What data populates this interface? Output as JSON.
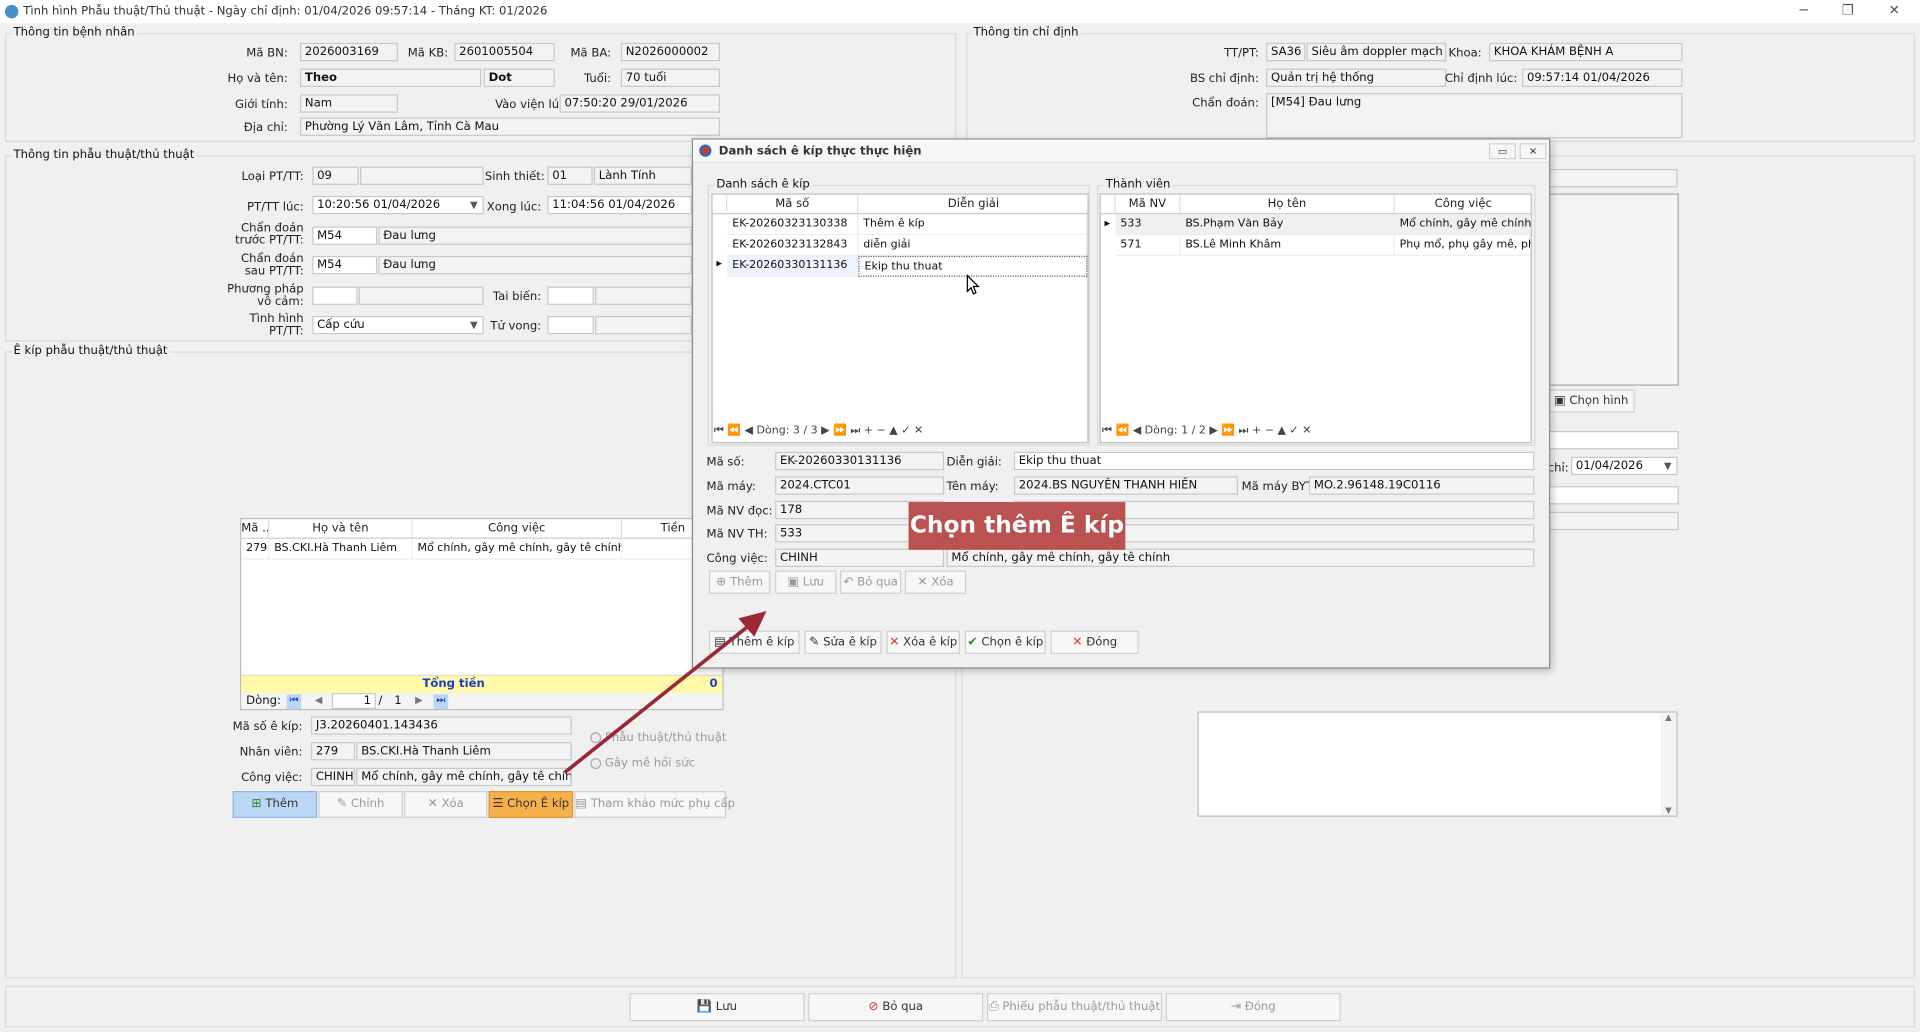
{
  "window": {
    "title": "Tình hình Phẫu thuật/Thủ thuật - Ngày chỉ định: 01/04/2026 09:57:14 - Tháng KT: 01/2026",
    "controls": [
      "─",
      "❐",
      "✕"
    ]
  },
  "patient_info": {
    "group_title": "Thông tin bệnh nhân",
    "ma_bn_label": "Mã BN:",
    "ma_bn": "2026003169",
    "ma_kb_label": "Mã KB:",
    "ma_kb": "2601005504",
    "ma_ba_label": "Mã BA:",
    "ma_ba": "N2026000002",
    "ho_ten_label": "Họ và tên:",
    "ho": "Theo",
    "ten": "Dot",
    "tuoi_label": "Tuổi:",
    "tuoi": "70 tuổi",
    "gioi_tinh_label": "Giới tính:",
    "gioi_tinh": "Nam",
    "vao_vien_label": "Vào viện lúc:",
    "vao_vien": "07:50:20 29/01/2026",
    "dia_chi_label": "Địa chỉ:",
    "dia_chi": "Phường Lý Văn Lâm, Tỉnh Cà Mau"
  },
  "order_info": {
    "group_title": "Thông tin chỉ định",
    "ttpt_label": "TT/PT:",
    "ttpt_code": "SA36",
    "ttpt_name": "Siêu âm doppler mạch máu",
    "khoa_label": "Khoa:",
    "khoa": "KHOA KHÁM BỆNH A",
    "bs_label": "BS chỉ định:",
    "bs": "Quản trị hệ thống",
    "chi_dinh_luc_label": "Chỉ định lúc:",
    "chi_dinh_luc": "09:57:14 01/04/2026",
    "chan_doan_label": "Chẩn đoán:",
    "chan_doan": "[M54] Đau lưng"
  },
  "surgery_info": {
    "group_title": "Thông tin phẫu thuật/thủ thuật",
    "loai_label": "Loại PT/TT:",
    "loai": "09",
    "sinh_thiet_label": "Sinh thiết:",
    "sinh_thiet_code": "01",
    "sinh_thiet": "Lành Tính",
    "pttt_luc_label": "PT/TT lúc:",
    "pttt_luc": "10:20:56 01/04/2026",
    "xong_luc_label": "Xong lúc:",
    "xong_luc": "11:04:56 01/04/2026",
    "cd_truoc_label_1": "Chẩn đoán",
    "cd_truoc_label_2": "trước PT/TT:",
    "cd_truoc_code": "M54",
    "cd_truoc": "Đau lưng",
    "cd_sau_label_1": "Chẩn đoán",
    "cd_sau_label_2": "sau PT/TT:",
    "cd_sau_code": "M54",
    "cd_sau": "Đau lưng",
    "pp_vo_cam_label_1": "Phương pháp",
    "pp_vo_cam_label_2": "vô cảm:",
    "tai_bien_label": "Tai biến:",
    "tinh_hinh_label_1": "Tình hình",
    "tinh_hinh_label_2": "PT/TT:",
    "tinh_hinh": "Cấp cứu",
    "tu_vong_label": "Tử vong:"
  },
  "team_section": {
    "group_title": "Ê kíp phẫu thuật/thủ thuật",
    "grid_headers": [
      "Mã ...",
      "Họ và tên",
      "Công việc",
      "Tiền"
    ],
    "rows": [
      {
        "ma": "279",
        "ho_ten": "BS.CKI.Hà Thanh Liêm",
        "cong_viec": "Mổ chính, gây mê chính, gây tê chính",
        "tien": ""
      }
    ],
    "total_label": "Tổng tiền",
    "total_value": "0",
    "nav_label": "Dòng:",
    "nav_current": "1",
    "nav_sep": "/",
    "nav_total": "1",
    "ma_so_ekip_label": "Mã số ê kíp:",
    "ma_so_ekip": "J3.20260401.143436",
    "nhan_vien_label": "Nhân viên:",
    "nhan_vien_code": "279",
    "nhan_vien": "BS.CKI.Hà Thanh Liêm",
    "cong_viec_label": "Công việc:",
    "cong_viec_code": "CHINH",
    "cong_viec": "Mổ chính, gây mê chính, gây tê chính",
    "radio_1": "Phẫu thuật/thủ thuật",
    "radio_2": "Gây mê hồi sức",
    "btn_them": "Thêm",
    "btn_chinh": "Chỉnh",
    "btn_xoa": "Xóa",
    "btn_chon_ekip": "Chọn Ê kíp",
    "btn_tham_khao": "Tham khảo mức phụ cấp"
  },
  "right_panel": {
    "chon_hinh": "Chọn hình",
    "ngay_label": "chỉ:",
    "ngay": "01/04/2026"
  },
  "dialog": {
    "title": "Danh sách ê kíp thực thực hiện",
    "list_group_title": "Danh sách ê kíp",
    "list_headers": [
      "Mã số",
      "Diễn giải"
    ],
    "list_rows": [
      {
        "ma_so": "EK-20260323130338",
        "dien_giai": "Thêm ê kíp"
      },
      {
        "ma_so": "EK-20260323132843",
        "dien_giai": "diễn giải"
      },
      {
        "ma_so": "EK-20260330131136",
        "dien_giai": "Ekip thu thuat"
      }
    ],
    "list_nav": "Dòng: 3 / 3",
    "member_group_title": "Thành viên",
    "member_headers": [
      "Mã NV",
      "Họ tên",
      "Công việc"
    ],
    "member_rows": [
      {
        "ma_nv": "533",
        "ho_ten": "BS.Phạm Văn Bảy",
        "cong_viec": "Mổ chính, gây mê chính,..."
      },
      {
        "ma_nv": "571",
        "ho_ten": "BS.Lê Minh Khâm",
        "cong_viec": "Phụ mổ, phụ gây mê, ph..."
      }
    ],
    "member_nav": "Dòng: 1 / 2",
    "ma_so_label": "Mã số:",
    "ma_so": "EK-20260330131136",
    "dien_giai_label": "Diễn giải:",
    "dien_giai": "Ekip thu thuat",
    "ma_may_label": "Mã máy:",
    "ma_may": "2024.CTC01",
    "ten_may_label": "Tên máy:",
    "ten_may": "2024.BS NGUYỄN THANH HIỀN",
    "ma_may_byt_label": "Mã máy BYT:",
    "ma_may_byt": "MO.2.96148.19C0116",
    "ma_nv_doc_label": "Mã NV đọc:",
    "ma_nv_doc": "178",
    "ma_nv_th_label": "Mã NV TH:",
    "ma_nv_th": "533",
    "cong_viec_label": "Công việc:",
    "cong_viec_code": "CHINH",
    "cong_viec": "Mổ chính, gây mê chính, gây tê chính",
    "btn_them": "Thêm",
    "btn_luu": "Lưu",
    "btn_bo_qua": "Bỏ qua",
    "btn_xoa": "Xóa",
    "btn_them_ekip": "Thêm ê kíp",
    "btn_sua_ekip": "Sửa ê kíp",
    "btn_xoa_ekip": "Xóa  ê kíp",
    "btn_chon_ekip": "Chọn  ê kíp",
    "btn_dong": "Đóng"
  },
  "annotation": {
    "callout_text": "Chọn thêm Ê kíp",
    "color": "#b84a4a"
  },
  "footer": {
    "btn_luu": "Lưu",
    "btn_bo_qua": "Bỏ qua",
    "btn_phieu": "Phiếu phẫu thuật/thủ thuật",
    "btn_dong": "Đóng"
  },
  "colors": {
    "accent_orange": "#f5b04a",
    "accent_blue": "#bcd7f5",
    "total_yellow": "#fff9a8",
    "total_blue_text": "#1a3fbf",
    "delete_red": "#d23a2a"
  }
}
